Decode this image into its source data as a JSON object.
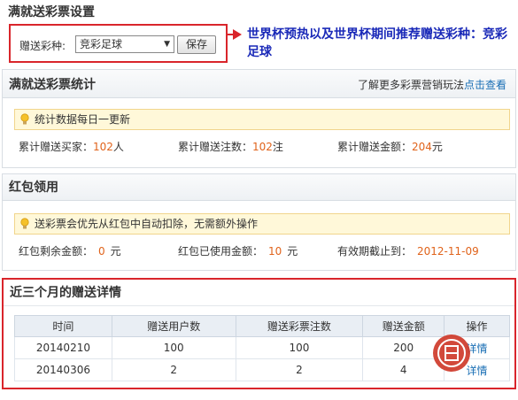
{
  "settings": {
    "title": "满就送彩票设置",
    "lottery_label": "赠送彩种:",
    "lottery_selected": "竞彩足球",
    "save_label": "保存",
    "annotation": "世界杯预热以及世界杯期间推荐赠送彩种：竞彩足球"
  },
  "stats": {
    "title": "满就送彩票统计",
    "more_prefix": "了解更多彩票营销玩法",
    "more_link": "点击查看",
    "tip": "统计数据每日一更新",
    "buyers_label": "累计赠送买家：",
    "buyers_value": "102",
    "buyers_unit": "人",
    "bets_label": "累计赠送注数：",
    "bets_value": "102",
    "bets_unit": "注",
    "amount_label": "累计赠送金额：",
    "amount_value": "204",
    "amount_unit": "元"
  },
  "redpacket": {
    "title": "红包领用",
    "tip": "送彩票会优先从红包中自动扣除，无需额外操作",
    "remaining_label": "红包剩余金额：",
    "remaining_value": "0",
    "remaining_unit": "元",
    "used_label": "红包已使用金额：",
    "used_value": "10",
    "used_unit": "元",
    "expiry_label": "有效期截止到：",
    "expiry_value": "2012-11-09"
  },
  "details": {
    "title": "近三个月的赠送详情",
    "columns": [
      "时间",
      "赠送用户数",
      "赠送彩票注数",
      "赠送金额",
      "操作"
    ],
    "rows": [
      {
        "date": "20140210",
        "users": "100",
        "bets": "100",
        "amount": "200",
        "action": "详情"
      },
      {
        "date": "20140306",
        "users": "2",
        "bets": "2",
        "amount": "4",
        "action": "详情"
      }
    ]
  },
  "colors": {
    "highlight_border": "#d9252b",
    "annotation_text": "#1a29b8",
    "number_accent": "#e0631b",
    "link": "#1a6fb5",
    "tip_background": "#fff8d9"
  },
  "icons": [
    "lightbulb-icon",
    "dropdown-arrow-icon",
    "seal-stamp"
  ]
}
